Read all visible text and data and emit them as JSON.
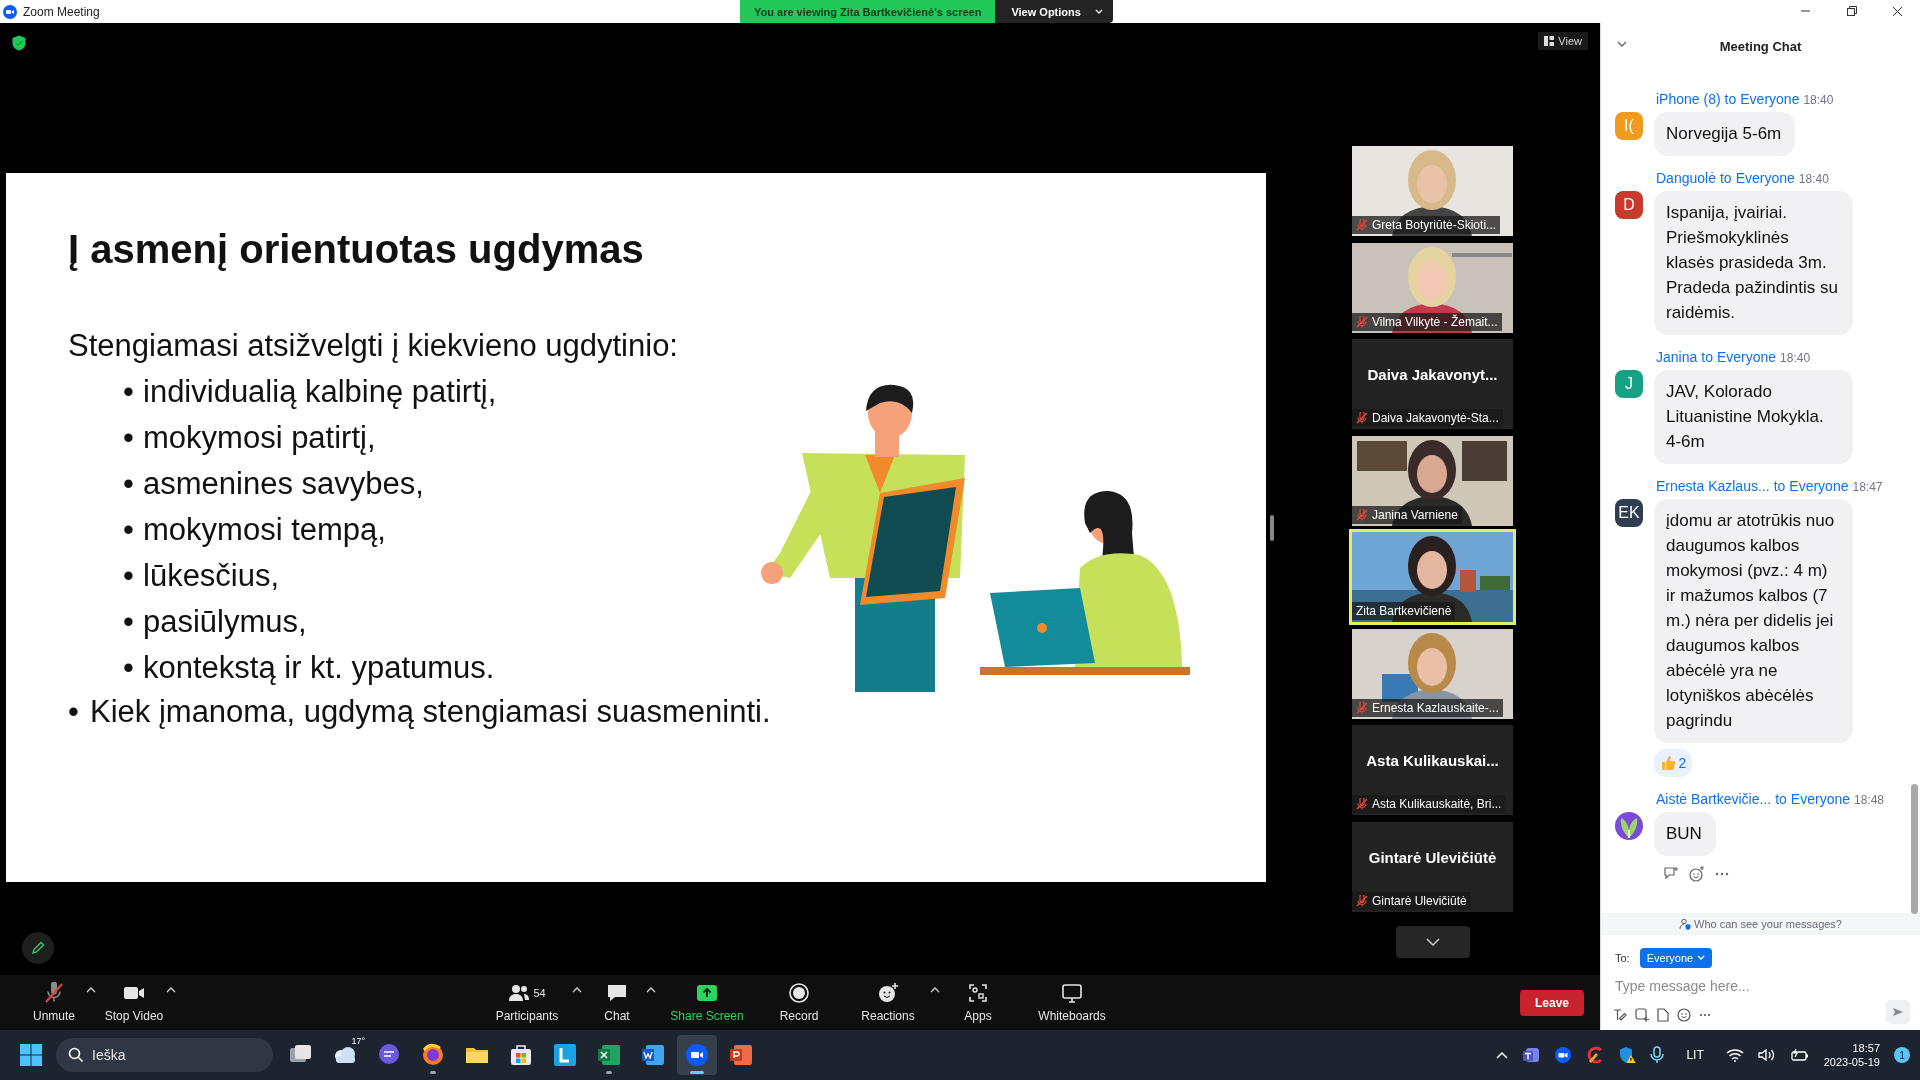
{
  "window": {
    "title": "Zoom Meeting"
  },
  "share_banner": {
    "text": "You are viewing Zita Bartkevičienė's screen",
    "options_button": "View Options"
  },
  "view_button": "View",
  "slide": {
    "title": "Į asmenį orientuotas ugdymas",
    "intro": "Stengiamasi atsižvelgti į kiekvieno ugdytinio:",
    "bullets": [
      {
        "mark": "•",
        "text": "individualią kalbinę patirtį,"
      },
      {
        "mark": "•",
        "text": "mokymosi patirtį,"
      },
      {
        "mark": "•",
        "text": "asmenines savybes,"
      },
      {
        "mark": "•",
        "text": "mokymosi tempą,"
      },
      {
        "mark": "•",
        "text": "lūkesčius,"
      },
      {
        "mark": "•",
        "text": "pasiūlymus,"
      },
      {
        "mark": "•",
        "text": "kontekstą ir kt. ypatumus."
      }
    ],
    "closing": {
      "mark": "•",
      "text": "Kiek įmanoma, ugdymą stengiamasi suasmeninti."
    }
  },
  "participants": [
    {
      "kind": "video",
      "name": "Greta Botyriūtė-Skioti...",
      "muted": true,
      "speaking": false
    },
    {
      "kind": "video",
      "name": "Vilma Vilkytė - Žemait...",
      "muted": true,
      "speaking": false
    },
    {
      "kind": "avatar",
      "display_name": "Daiva Jakavonyt...",
      "name": "Daiva Jakavonytė-Sta...",
      "muted": true,
      "speaking": false
    },
    {
      "kind": "video",
      "name": "Janina Varniene",
      "muted": true,
      "speaking": false
    },
    {
      "kind": "video",
      "name": "Zita Bartkevičienė",
      "muted": false,
      "speaking": true
    },
    {
      "kind": "video",
      "name": "Ernesta Kazlauskaite-...",
      "muted": true,
      "speaking": false
    },
    {
      "kind": "avatar",
      "display_name": "Asta Kulikauskai...",
      "name": "Asta Kulikauskaitė, Bri...",
      "muted": true,
      "speaking": false
    },
    {
      "kind": "avatar",
      "display_name": "Gintarė Ulevičiūtė",
      "name": "Gintarė Ulevičiūtė",
      "muted": true,
      "speaking": false
    }
  ],
  "chat": {
    "title": "Meeting Chat",
    "messages": [
      {
        "sender": "iPhone (8)",
        "to_label": "to",
        "recipient": "Everyone",
        "time": "18:40",
        "avatar": {
          "kind": "initials",
          "text": "I(",
          "color": "#f29a1b"
        },
        "text": "Norvegija 5-6m"
      },
      {
        "sender": "Danguolė",
        "to_label": "to",
        "recipient": "Everyone",
        "time": "18:40",
        "avatar": {
          "kind": "initials",
          "text": "D",
          "color": "#c53b2c"
        },
        "text": "Ispanija, įvairiai. Priešmokyklinės klasės prasideda 3m. Pradeda pažindintis su raidėmis."
      },
      {
        "sender": "Janina",
        "to_label": "to",
        "recipient": "Everyone",
        "time": "18:40",
        "avatar": {
          "kind": "initials",
          "text": "J",
          "color": "#16a185"
        },
        "text": "JAV, Kolorado Lituanistine Mokykla. 4-6m"
      },
      {
        "sender": "Ernesta Kazlaus...",
        "to_label": "to",
        "recipient": "Everyone",
        "time": "18:47",
        "avatar": {
          "kind": "initials",
          "text": "EK",
          "color": "#2f3e50"
        },
        "text": "įdomu ar atotrūkis nuo daugumos kalbos mokymosi (pvz.: 4 m) ir mažumos kalbos (7 m.) nėra per didelis jei daugumos kalbos abėcėlė yra ne lotyniškos abėcėlės pagrindu",
        "reactions": [
          {
            "kind": "thumbs-up",
            "count": "2"
          }
        ]
      },
      {
        "sender": "Aistė Bartkevičie...",
        "to_label": "to",
        "recipient": "Everyone",
        "time": "18:48",
        "text": "BUN",
        "actions": true
      }
    ],
    "privacy_note": "Who can see your messages?",
    "to_label": "To:",
    "recipient": "Everyone",
    "placeholder": "Type message here..."
  },
  "toolbar": {
    "items": [
      {
        "kind": "mic-muted",
        "label": "Unmute",
        "caret": true
      },
      {
        "kind": "camera",
        "label": "Stop Video",
        "caret": true
      },
      {
        "kind": "participants",
        "label": "Participants",
        "count": "54",
        "caret": true
      },
      {
        "kind": "chat",
        "label": "Chat",
        "caret": true
      },
      {
        "kind": "share",
        "label": "Share Screen",
        "caret": false
      },
      {
        "kind": "record",
        "label": "Record",
        "caret": false
      },
      {
        "kind": "reactions",
        "label": "Reactions",
        "caret": true
      },
      {
        "kind": "apps",
        "label": "Apps",
        "caret": false
      },
      {
        "kind": "whiteboard",
        "label": "Whiteboards",
        "caret": false
      }
    ],
    "leave": "Leave"
  },
  "taskbar": {
    "search_placeholder": "Ieška",
    "apps": [
      {
        "kind": "task-view",
        "running": false,
        "selected": false
      },
      {
        "kind": "weather",
        "text": "17°",
        "running": false,
        "selected": false
      },
      {
        "kind": "chat",
        "running": false,
        "selected": false
      },
      {
        "kind": "browser",
        "running": true,
        "selected": false
      },
      {
        "kind": "folder",
        "running": false,
        "selected": false
      },
      {
        "kind": "store",
        "running": false,
        "selected": false
      },
      {
        "kind": "tile",
        "running": false,
        "selected": false
      },
      {
        "kind": "spreadsheet",
        "running": true,
        "selected": false
      },
      {
        "kind": "document",
        "running": false,
        "selected": false
      },
      {
        "kind": "video",
        "running": true,
        "selected": true
      },
      {
        "kind": "presentation",
        "running": false,
        "selected": false
      }
    ],
    "tray": {
      "language": "LIT",
      "time": "18:57",
      "date": "2023-05-19",
      "notifications": "1"
    }
  }
}
